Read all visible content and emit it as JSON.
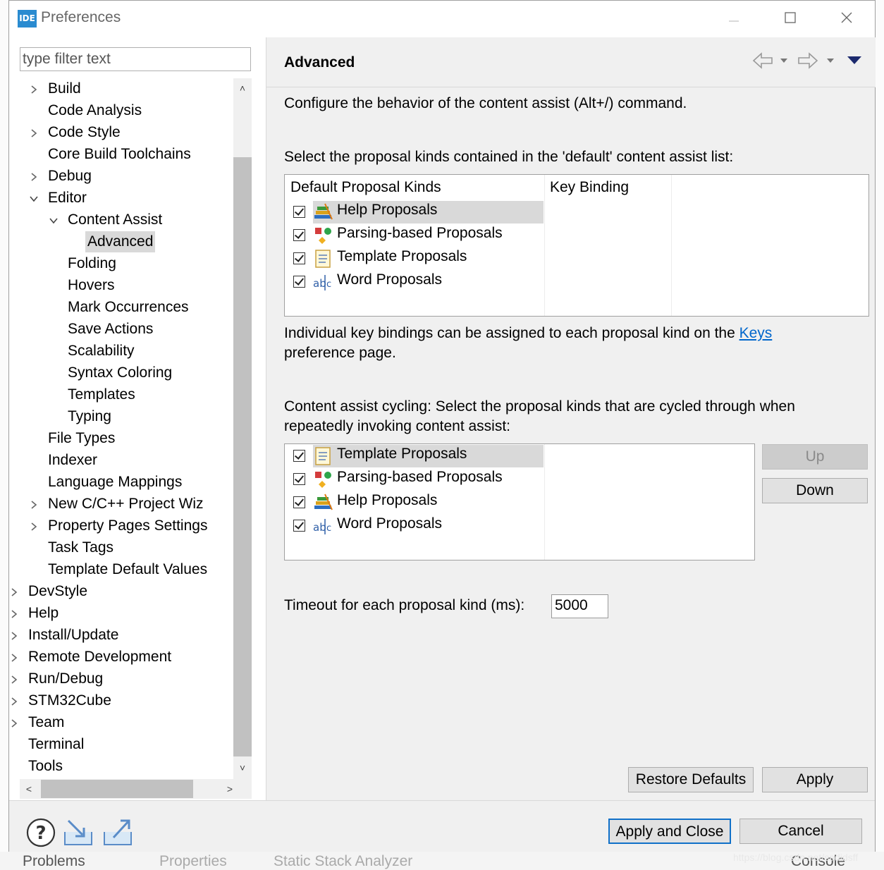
{
  "window": {
    "title": "Preferences",
    "app_icon": "IDE"
  },
  "filter": {
    "placeholder": "type filter text"
  },
  "tree": [
    {
      "label": "Build",
      "level": 2,
      "twisty": "collapsed"
    },
    {
      "label": "Code Analysis",
      "level": 2,
      "twisty": ""
    },
    {
      "label": "Code Style",
      "level": 2,
      "twisty": "collapsed"
    },
    {
      "label": "Core Build Toolchains",
      "level": 2,
      "twisty": ""
    },
    {
      "label": "Debug",
      "level": 2,
      "twisty": "collapsed"
    },
    {
      "label": "Editor",
      "level": 2,
      "twisty": "expanded"
    },
    {
      "label": "Content Assist",
      "level": 3,
      "twisty": "expanded"
    },
    {
      "label": "Advanced",
      "level": 4,
      "twisty": "",
      "selected": true
    },
    {
      "label": "Folding",
      "level": 3,
      "twisty": ""
    },
    {
      "label": "Hovers",
      "level": 3,
      "twisty": ""
    },
    {
      "label": "Mark Occurrences",
      "level": 3,
      "twisty": ""
    },
    {
      "label": "Save Actions",
      "level": 3,
      "twisty": ""
    },
    {
      "label": "Scalability",
      "level": 3,
      "twisty": ""
    },
    {
      "label": "Syntax Coloring",
      "level": 3,
      "twisty": ""
    },
    {
      "label": "Templates",
      "level": 3,
      "twisty": ""
    },
    {
      "label": "Typing",
      "level": 3,
      "twisty": ""
    },
    {
      "label": "File Types",
      "level": 2,
      "twisty": ""
    },
    {
      "label": "Indexer",
      "level": 2,
      "twisty": ""
    },
    {
      "label": "Language Mappings",
      "level": 2,
      "twisty": ""
    },
    {
      "label": "New C/C++ Project Wiz",
      "level": 2,
      "twisty": "collapsed"
    },
    {
      "label": "Property Pages Settings",
      "level": 2,
      "twisty": "collapsed"
    },
    {
      "label": "Task Tags",
      "level": 2,
      "twisty": ""
    },
    {
      "label": "Template Default Values",
      "level": 2,
      "twisty": ""
    },
    {
      "label": "DevStyle",
      "level": 1,
      "twisty": "collapsed"
    },
    {
      "label": "Help",
      "level": 1,
      "twisty": "collapsed"
    },
    {
      "label": "Install/Update",
      "level": 1,
      "twisty": "collapsed"
    },
    {
      "label": "Remote Development",
      "level": 1,
      "twisty": "collapsed"
    },
    {
      "label": "Run/Debug",
      "level": 1,
      "twisty": "collapsed"
    },
    {
      "label": "STM32Cube",
      "level": 1,
      "twisty": "collapsed"
    },
    {
      "label": "Team",
      "level": 1,
      "twisty": "collapsed"
    },
    {
      "label": "Terminal",
      "level": 1,
      "twisty": ""
    },
    {
      "label": "Tools",
      "level": 1,
      "twisty": ""
    }
  ],
  "page": {
    "title": "Advanced",
    "description": "Configure the behavior of the content assist (Alt+/) command.",
    "default_list_label": "Select the proposal kinds contained in the 'default' content assist list:",
    "default_table": {
      "headers": [
        "Default Proposal Kinds",
        "Key Binding"
      ],
      "rows": [
        {
          "label": "Help Proposals",
          "icon": "help-proposals-icon",
          "checked": true,
          "selected": true
        },
        {
          "label": "Parsing-based Proposals",
          "icon": "parsing-proposals-icon",
          "checked": true
        },
        {
          "label": "Template Proposals",
          "icon": "template-proposals-icon",
          "checked": true
        },
        {
          "label": "Word Proposals",
          "icon": "word-proposals-icon",
          "checked": true
        }
      ]
    },
    "keys_note_prefix": "Individual key bindings can be assigned to each proposal kind on the ",
    "keys_link": "Keys",
    "keys_note_suffix": "preference page.",
    "cycling_label_line1": "Content assist cycling: Select the proposal kinds that are cycled through when",
    "cycling_label_line2": "repeatedly invoking content assist:",
    "cycling_table": {
      "rows": [
        {
          "label": "Template Proposals",
          "icon": "template-proposals-icon",
          "checked": true,
          "selected": true
        },
        {
          "label": "Parsing-based Proposals",
          "icon": "parsing-proposals-icon",
          "checked": true
        },
        {
          "label": "Help Proposals",
          "icon": "help-proposals-icon",
          "checked": true
        },
        {
          "label": "Word Proposals",
          "icon": "word-proposals-icon",
          "checked": true
        }
      ]
    },
    "up_label": "Up",
    "down_label": "Down",
    "timeout_label": "Timeout for each proposal kind (ms):",
    "timeout_value": "5000",
    "restore_defaults_label": "Restore Defaults",
    "apply_label": "Apply"
  },
  "footer": {
    "apply_close_label": "Apply and Close",
    "cancel_label": "Cancel"
  },
  "background": {
    "tabs": [
      "Problems",
      "Properties",
      "Static Stack Analyzer",
      "Console"
    ],
    "watermark": "https://blog.csdn.net/sadidsff"
  },
  "colors": {
    "link": "#0066cc",
    "selection": "#d9d9d9",
    "default_button_border": "#1070c8"
  }
}
